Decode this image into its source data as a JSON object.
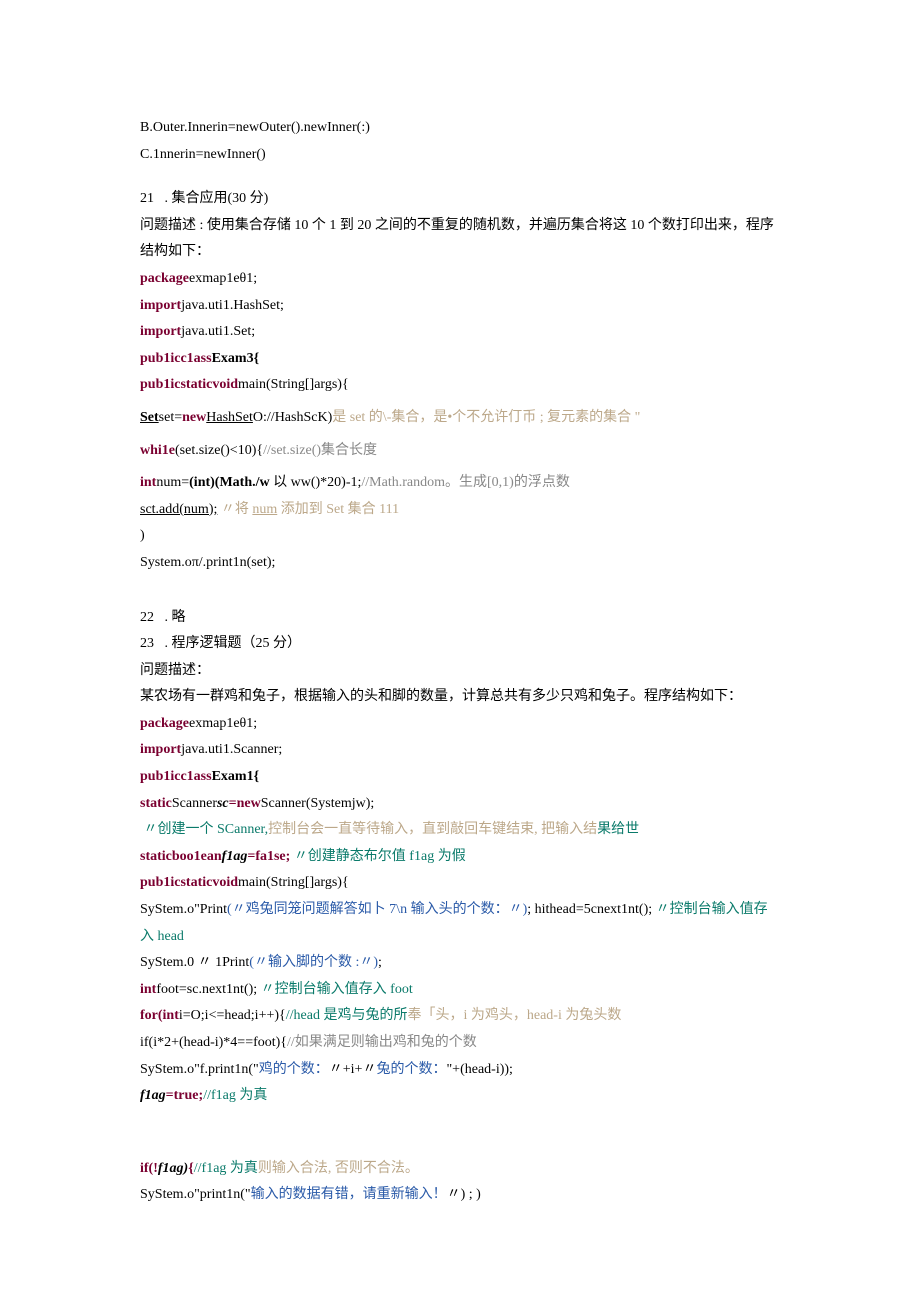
{
  "lines": {
    "l1": "B.Outer.Innerin=newOuter().newInner(:)",
    "l2": "C.1nnerin=newInner()",
    "l3": "21   . 集合应用(30 分)",
    "l4": "问题描述 : 使用集合存储 10 个 1 到 20 之间的不重复的随机数，并遍历集合将这 10 个数打印出来，程序结构如下：",
    "l5a": "package",
    "l5b": "exmap1eθ1;",
    "l6a": "import",
    "l6b": "java.uti1.HashSet;",
    "l7a": "import",
    "l7b": "java.uti1.Set;",
    "l8a": "pub1icc1ass",
    "l8b": "Exam3{",
    "l9a": "pub1icstaticvoid",
    "l9b": "main(String[]args){",
    "l10a": "Set",
    "l10b": "set=",
    "l10c": "new",
    "l10d": "HashSet",
    "l10e": "O://HashScK)",
    "l10f": "是 set 的\\-集合，是•个不允许仃币 ; 复元素的集合 \"",
    "l11a": "whi1e",
    "l11b": "(set.size()<10){",
    "l11c": "//set.size()集合长度",
    "l12a": "int",
    "l12b": "num=",
    "l12c": "(int)(Math./w",
    "l12d": " 以 ww()*20)-1;",
    "l12e": "//Math.random。生成[0,1)的浮点数",
    "l13a": "sct.add(num);",
    "l13b": " 〃将 ",
    "l13c": "num",
    "l13d": " 添加到 Set 集合 111",
    "l14": ")",
    "l15": "System.oπ/.print1n(set);",
    "l16": "22   . 略",
    "l17": "23   . 程序逻辑题（25 分）",
    "l18": "问题描述：",
    "l19": "某农场有一群鸡和兔子，根据输入的头和脚的数量，计算总共有多少只鸡和兔子。程序结构如下：",
    "l20a": "package",
    "l20b": "exmap1eθ1;",
    "l21a": "import",
    "l21b": "java.uti1.Scanner;",
    "l22a": "pub1icc1ass",
    "l22b": "Exam1{",
    "l23a": "static",
    "l23b": "Scanner",
    "l23c": "sc",
    "l23d": "=new",
    "l23e": "Scanner(Systemjw);",
    "l24a": " 〃创建一个 SCanner,",
    "l24b": "控制台会一直等待输入，直到敲回车键结束, 把输入结",
    "l24c": "果给世",
    "l25a": "staticboo1ean",
    "l25b": "f1ag",
    "l25c": "=fa1se;",
    "l25d": " 〃创建静态布尔值 f1ag 为假",
    "l26a": "pub1icstaticvoid",
    "l26b": "main(String[]args){",
    "l27a": "SyStem.o\"Print",
    "l27b": "(〃鸡兔同笼问题解答如卜 7\\n 输入头的个数：〃)",
    "l27c": "; hithead=5cnext1nt();",
    "l27d": " 〃控制台输入值存入 head",
    "l28a": "SyStem.0 〃 1Print",
    "l28b": "(〃输入脚的个数 :〃)",
    "l28c": ";",
    "l29a": "int",
    "l29b": "foot=sc.next1nt();",
    "l29c": " 〃控制台输入值存入 foot",
    "l30a": "for(int",
    "l30b": "i=O;i<=head;i++){",
    "l30c": "//head 是鸡与兔的所",
    "l30d": "奉「头，i 为鸡头，head-i 为兔头数",
    "l31a": "if(i*2+(head-i)*4==foot){",
    "l31b": "//如果满足则输出鸡和兔的个数",
    "l32a": "SyStem.o\"f.print1n(\"",
    "l32b": "鸡的个数：",
    "l32c": "〃+i+〃",
    "l32d": "兔的个数：",
    "l32e": "\"+(head-i));",
    "l33a": "f1ag",
    "l33b": "=true;",
    "l33c": "//f1ag 为真",
    "l34a": "if(!",
    "l34b": "f1ag)",
    "l34c": "{",
    "l34d": "//f1ag 为真",
    "l34e": "则输入合法, 否则不合法。",
    "l35a": "SyStem.o\"print1n(\"",
    "l35b": "输入的数据有错，请重新输入！",
    "l35c": "〃) ; )"
  }
}
